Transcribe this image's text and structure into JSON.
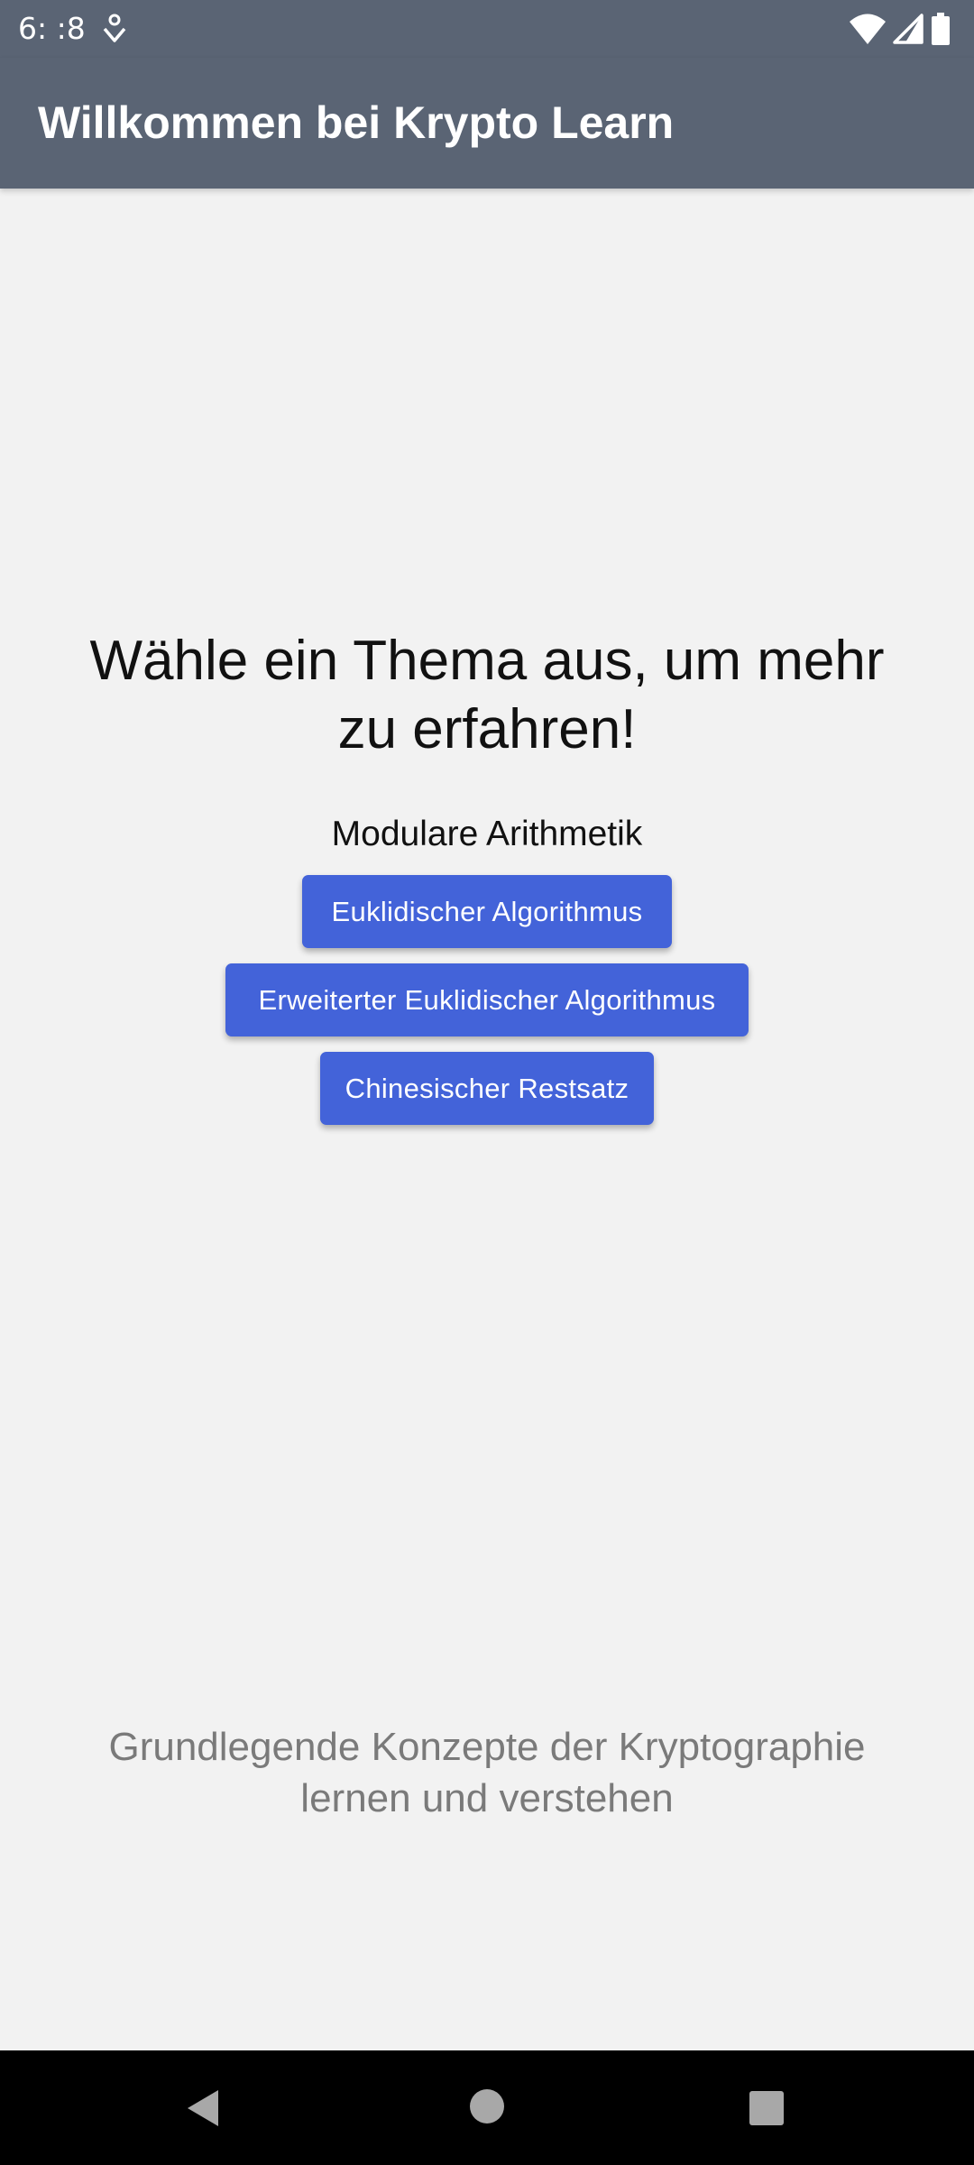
{
  "status_bar": {
    "time": "6: :8",
    "icons": [
      "notification-icon",
      "wifi-icon",
      "signal-icon",
      "battery-icon"
    ]
  },
  "app_bar": {
    "title": "Willkommen bei Krypto Learn"
  },
  "main": {
    "headline": "Wähle ein Thema aus, um mehr zu erfahren!",
    "topic_label": "Modulare Arithmetik",
    "buttons": [
      {
        "label": "Euklidischer Algorithmus"
      },
      {
        "label": "Erweiterter Euklidischer Algorithmus"
      },
      {
        "label": "Chinesischer Restsatz"
      }
    ],
    "footer": "Grundlegende Konzepte der Kryptographie lernen und verstehen"
  },
  "nav_bar": {
    "icons": [
      "back-icon",
      "home-icon",
      "recent-apps-icon"
    ]
  },
  "colors": {
    "app_bar": "#5a6474",
    "button": "#4363d9",
    "background": "#f2f2f2",
    "footer_text": "#7a7a7a"
  }
}
